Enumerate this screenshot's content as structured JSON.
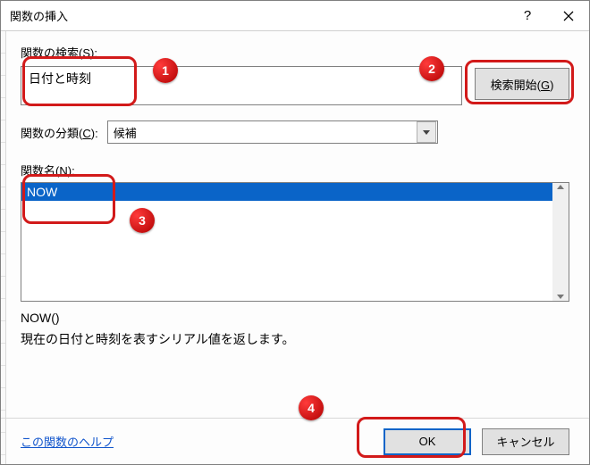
{
  "titlebar": {
    "title": "関数の挿入"
  },
  "search": {
    "label_pre": "関数の検索(",
    "label_ul": "S",
    "label_post": "):",
    "value": "日付と時刻",
    "button_pre": "検索開始(",
    "button_ul": "G",
    "button_post": ")"
  },
  "category": {
    "label_pre": "関数の分類(",
    "label_ul": "C",
    "label_post": "):",
    "selected": "候補"
  },
  "funclist": {
    "label_pre": "関数名(",
    "label_ul": "N",
    "label_post": "):",
    "items": [
      "NOW"
    ],
    "selected_index": 0
  },
  "detail": {
    "signature": "NOW()",
    "description": "現在の日付と時刻を表すシリアル値を返します。"
  },
  "footer": {
    "help_link": "この関数のヘルプ",
    "ok": "OK",
    "cancel": "キャンセル"
  },
  "annotations": {
    "b1": "1",
    "b2": "2",
    "b3": "3",
    "b4": "4"
  }
}
